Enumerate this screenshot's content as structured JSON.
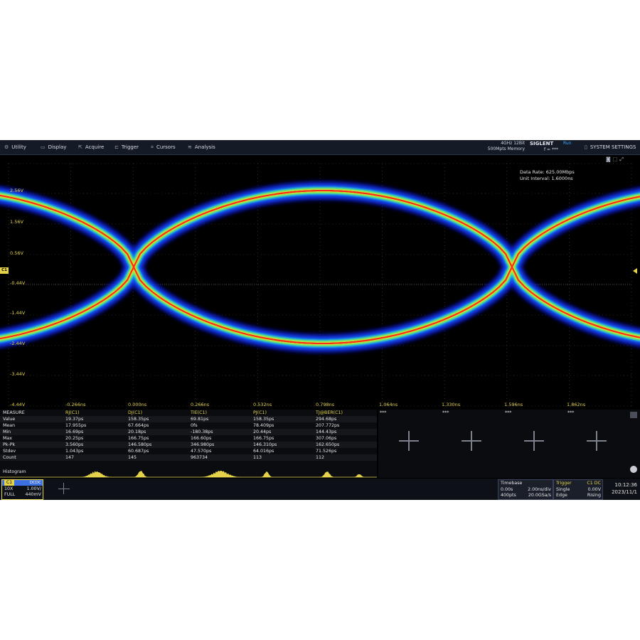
{
  "menubar": {
    "items": [
      {
        "label": "Utility",
        "icon": "utility-icon",
        "glyph": "⚙"
      },
      {
        "label": "Display",
        "icon": "display-icon",
        "glyph": "▭"
      },
      {
        "label": "Acquire",
        "icon": "acquire-icon",
        "glyph": "⇱"
      },
      {
        "label": "Trigger",
        "icon": "trigger-icon",
        "glyph": "⊏"
      },
      {
        "label": "Cursors",
        "icon": "cursors-icon",
        "glyph": "⌗"
      },
      {
        "label": "Analysis",
        "icon": "analysis-icon",
        "glyph": "≋"
      }
    ],
    "spec_line1": "4GHz 12Bit",
    "spec_line2": "500Mpts Memory",
    "brand": "SIGLENT",
    "run_state": "Run",
    "trigger_indicator": "f = ***",
    "system_settings": "SYSTEM SETTINGS"
  },
  "waveform": {
    "data_rate": "Data Rate: 625.00Mbps",
    "unit_interval": "Unit Interval: 1.6000ns",
    "channel_marker": "C1",
    "voltage_labels": [
      "2.56V",
      "1.56V",
      "0.56V",
      "-0.44V",
      "-1.44V",
      "-2.44V",
      "-3.44V",
      "-4.44V"
    ],
    "time_labels": [
      "-0.266ns",
      "0.000ns",
      "0.266ns",
      "0.532ns",
      "0.798ns",
      "1.064ns",
      "1.330ns",
      "1.596ns",
      "1.862ns"
    ]
  },
  "measure": {
    "headers": [
      "MEASURE",
      "RJ(C1)",
      "DJ(C1)",
      "TIE(C1)",
      "PJ(C1)",
      "TJ@BER(C1)"
    ],
    "rows": [
      {
        "label": "Value",
        "values": [
          "19.37ps",
          "158.35ps",
          "69.81ps",
          "158.35ps",
          "294.68ps"
        ]
      },
      {
        "label": "Mean",
        "values": [
          "17.955ps",
          "67.664ps",
          "0fs",
          "78.409ps",
          "207.772ps"
        ]
      },
      {
        "label": "Min",
        "values": [
          "16.69ps",
          "20.18ps",
          "-180.38ps",
          "20.44ps",
          "144.43ps"
        ]
      },
      {
        "label": "Max",
        "values": [
          "20.25ps",
          "166.75ps",
          "166.60ps",
          "166.75ps",
          "307.06ps"
        ]
      },
      {
        "label": "Pk-Pk",
        "values": [
          "3.560ps",
          "146.580ps",
          "346.980ps",
          "146.310ps",
          "162.650ps"
        ]
      },
      {
        "label": "Stdev",
        "values": [
          "1.043ps",
          "60.687ps",
          "47.570ps",
          "64.016ps",
          "71.526ps"
        ]
      },
      {
        "label": "Count",
        "values": [
          "147",
          "145",
          "963734",
          "113",
          "112"
        ]
      }
    ],
    "histogram_label": "Histogram",
    "extra_headers": [
      "***",
      "***",
      "***",
      "***"
    ]
  },
  "channel": {
    "name": "C1",
    "coupling": "DCDC",
    "probe": "10X",
    "scale": "1.00V/",
    "bandwidth": "FULL",
    "offset": "440mV"
  },
  "timebase": {
    "title": "Timebase",
    "delay": "0.00s",
    "scale": "2.00ns/div",
    "memory": "400pts",
    "sample_rate": "20.0GSa/s"
  },
  "trigger": {
    "title": "Trigger",
    "source": "C1 DC",
    "mode": "Single",
    "level": "0.00V",
    "type": "Edge",
    "slope": "Rising"
  },
  "clock": {
    "time": "10:12:36",
    "date": "2023/11/1"
  },
  "colors": {
    "accent_yellow": "#e3d24a",
    "run_blue": "#3aa6ff",
    "eye_hot": "#ff2a1a",
    "eye_cold": "#1a28ff"
  }
}
